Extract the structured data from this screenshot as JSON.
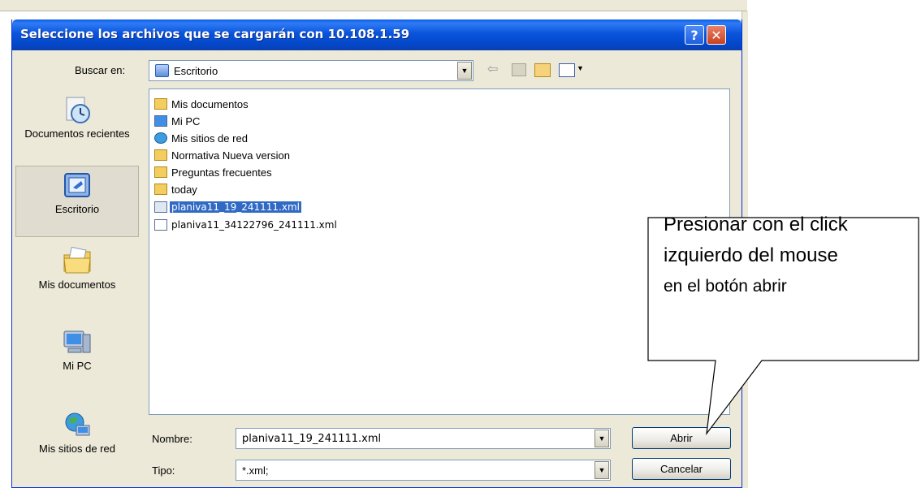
{
  "dialog": {
    "title": "Seleccione los archivos que se cargarán con 10.108.1.59",
    "help_glyph": "?",
    "close_glyph": "✕"
  },
  "lookin": {
    "label": "Buscar en:",
    "value": "Escritorio"
  },
  "places": [
    {
      "label": "Documentos recientes",
      "icon": "recent-documents-icon"
    },
    {
      "label": "Escritorio",
      "icon": "desktop-icon",
      "active": true
    },
    {
      "label": "Mis documentos",
      "icon": "my-documents-icon"
    },
    {
      "label": "Mi PC",
      "icon": "my-computer-icon"
    },
    {
      "label": "Mis sitios de red",
      "icon": "network-places-icon"
    }
  ],
  "files": [
    {
      "name": "Mis documentos",
      "icon": "my-documents-icon"
    },
    {
      "name": "Mi PC",
      "icon": "my-computer-icon"
    },
    {
      "name": "Mis sitios de red",
      "icon": "network-places-icon"
    },
    {
      "name": "Normativa Nueva version",
      "icon": "folder-icon"
    },
    {
      "name": "Preguntas frecuentes",
      "icon": "folder-icon"
    },
    {
      "name": "today",
      "icon": "folder-icon"
    },
    {
      "name": "planiva11_19_241111.xml",
      "icon": "xml-file-icon",
      "selected": true
    },
    {
      "name": "planiva11_34122796_241111.xml",
      "icon": "xml-file-icon"
    }
  ],
  "filename": {
    "label": "Nombre:",
    "value": "planiva11_19_241111.xml"
  },
  "filetype": {
    "label": "Tipo:",
    "value": "*.xml;"
  },
  "buttons": {
    "open": "Abrir",
    "cancel": "Cancelar"
  },
  "callout": {
    "line1": "Presionar con el click",
    "line2": "izquierdo del mouse",
    "line3": "en el botón abrir"
  },
  "colors": {
    "title_bar": "#0a54dc",
    "selection": "#316ac5",
    "dialog_bg": "#ece9d8"
  }
}
